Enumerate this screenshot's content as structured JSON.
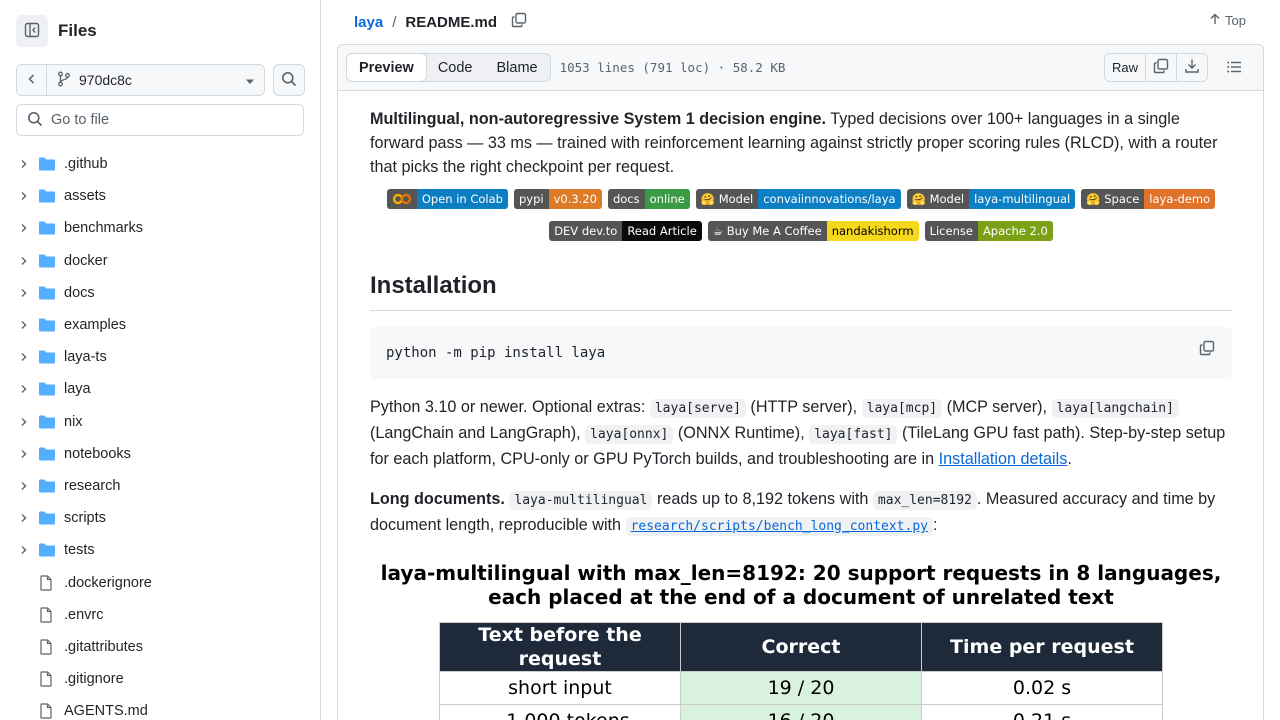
{
  "sidebar": {
    "title": "Files",
    "branch": "970dc8c",
    "goto_placeholder": "Go to file",
    "items": [
      {
        "name": ".github",
        "type": "dir"
      },
      {
        "name": "assets",
        "type": "dir"
      },
      {
        "name": "benchmarks",
        "type": "dir"
      },
      {
        "name": "docker",
        "type": "dir"
      },
      {
        "name": "docs",
        "type": "dir"
      },
      {
        "name": "examples",
        "type": "dir"
      },
      {
        "name": "laya-ts",
        "type": "dir"
      },
      {
        "name": "laya",
        "type": "dir"
      },
      {
        "name": "nix",
        "type": "dir"
      },
      {
        "name": "notebooks",
        "type": "dir"
      },
      {
        "name": "research",
        "type": "dir"
      },
      {
        "name": "scripts",
        "type": "dir"
      },
      {
        "name": "tests",
        "type": "dir"
      },
      {
        "name": ".dockerignore",
        "type": "file"
      },
      {
        "name": ".envrc",
        "type": "file"
      },
      {
        "name": ".gitattributes",
        "type": "file"
      },
      {
        "name": ".gitignore",
        "type": "file"
      },
      {
        "name": "AGENTS.md",
        "type": "file"
      }
    ]
  },
  "header": {
    "repo": "laya",
    "separator": "/",
    "file": "README.md",
    "top_label": "Top"
  },
  "file_header": {
    "tabs": [
      "Preview",
      "Code",
      "Blame"
    ],
    "meta": "1053 lines (791 loc) · 58.2 KB",
    "raw_label": "Raw"
  },
  "readme": {
    "intro_bold": "Multilingual, non-autoregressive System 1 decision engine.",
    "intro_rest": " Typed decisions over 100+ languages in a single forward pass — 33 ms — trained with reinforcement learning against strictly proper scoring rules (RLCD), with a router that picks the right checkpoint per request.",
    "badges": [
      {
        "left": "Open in Colab",
        "right": "",
        "left_color": "#555555",
        "right_color": "#0b7ec2",
        "type": "colab"
      },
      {
        "left": "pypi",
        "right": "v0.3.20",
        "left_color": "#555555",
        "right_color": "#dd7b27"
      },
      {
        "left": "docs",
        "right": "online",
        "left_color": "#555555",
        "right_color": "#3b9b45"
      },
      {
        "left": "🤗 Model",
        "right": "convaiinnovations/laya",
        "left_color": "#555555",
        "right_color": "#0d7fc4"
      },
      {
        "left": "🤗 Model",
        "right": "laya-multilingual",
        "left_color": "#555555",
        "right_color": "#0d7fc4"
      },
      {
        "left": "🤗 Space",
        "right": "laya-demo",
        "left_color": "#555555",
        "right_color": "#e0722a"
      },
      {
        "left": "DEV dev.to",
        "right": "Read Article",
        "left_color": "#555555",
        "right_color": "#0a0a0a"
      },
      {
        "left": "☕ Buy Me A Coffee",
        "right": "nandakishorm",
        "left_color": "#555555",
        "right_color": "#f5d71b"
      },
      {
        "left": "License",
        "right": "Apache 2.0",
        "left_color": "#555555",
        "right_color": "#7aa116"
      }
    ],
    "install_heading": "Installation",
    "install_cmd": "python -m pip install laya",
    "extras": {
      "t1": "Python 3.10 or newer. Optional extras: ",
      "c1": "laya[serve]",
      "t2": " (HTTP server), ",
      "c2": "laya[mcp]",
      "t3": " (MCP server), ",
      "c3": "laya[langchain]",
      "t4": " (LangChain and LangGraph), ",
      "c4": "laya[onnx]",
      "t5": " (ONNX Runtime), ",
      "c5": "laya[fast]",
      "t6": " (TileLang GPU fast path). Step-by-step setup for each platform, CPU-only or GPU PyTorch builds, and troubleshooting are in ",
      "link": "Installation details",
      "t7": "."
    },
    "long_docs": {
      "bold": "Long documents.",
      "c1": "laya-multilingual",
      "t1": " reads up to 8,192 tokens with ",
      "c2": "max_len=8192",
      "t2": ". Measured accuracy and time by document length, reproducible with ",
      "link": "research/scripts/bench_long_context.py",
      "t3": ":"
    },
    "figure": {
      "title_line1": "laya-multilingual with max_len=8192: 20 support requests in 8 languages,",
      "title_line2": "each placed at the end of a document of unrelated text",
      "columns": [
        "Text before the request",
        "Correct",
        "Time per request"
      ],
      "rows": [
        [
          "short input",
          "19 / 20",
          "0.02 s"
        ],
        [
          "~1,000 tokens",
          "16 / 20",
          "0.21 s"
        ]
      ]
    }
  }
}
